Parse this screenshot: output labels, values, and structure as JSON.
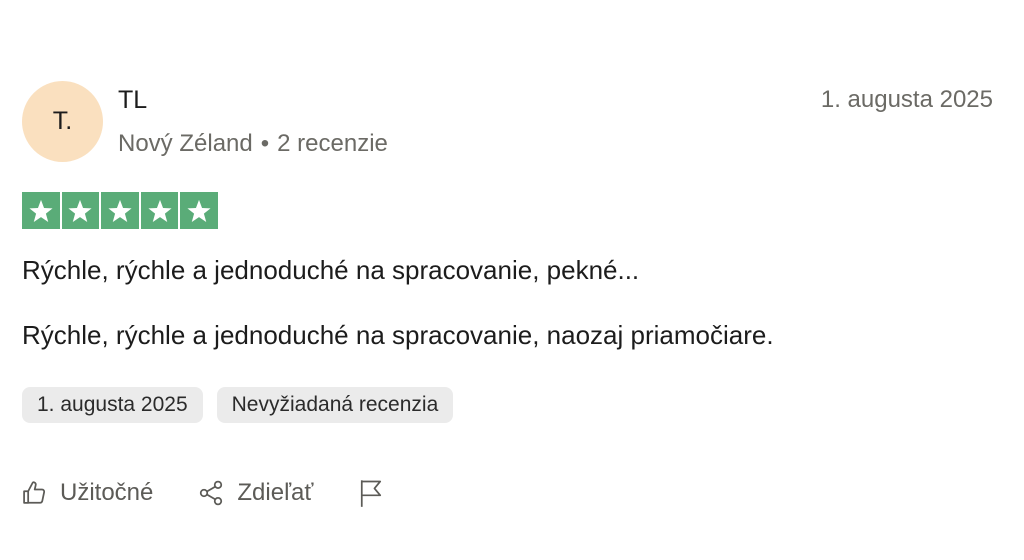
{
  "reviewer": {
    "avatar_initials": "T.",
    "avatar_color": "#fae0bf",
    "name": "TL",
    "country": "Nový Zéland",
    "separator": "•",
    "review_count": "2 recenzie"
  },
  "review": {
    "date": "1. augusta 2025",
    "rating": 5,
    "rating_max": 5,
    "star_color": "#5aac78",
    "title": "Rýchle, rýchle a jednoduché na spracovanie, pekné...",
    "body": "Rýchle, rýchle a jednoduché na spracovanie, naozaj priamočiare.",
    "tags": [
      "1. augusta 2025",
      "Nevyžiadaná recenzia"
    ]
  },
  "actions": {
    "helpful_label": "Užitočné",
    "helpful_icon": "thumbs-up-icon",
    "share_label": "Zdieľať",
    "share_icon": "share-icon",
    "report_icon": "flag-icon"
  }
}
